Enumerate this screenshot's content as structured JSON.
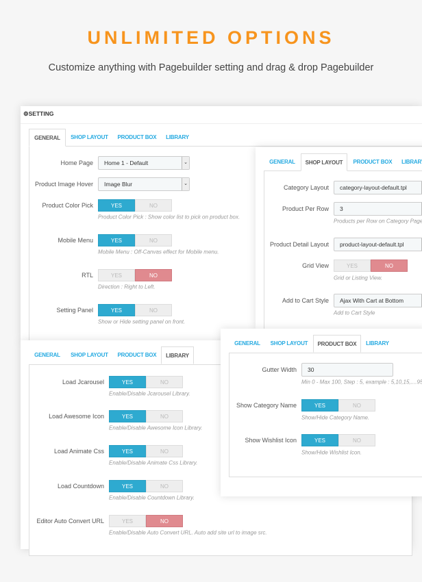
{
  "hero": {
    "title": "UNLIMITED OPTIONS",
    "subtitle": "Customize anything with Pagebuilder setting and drag & drop Pagebuilder"
  },
  "colors": {
    "accent": "#f7941d",
    "yes": "#2eaad0",
    "no": "#e08a8f",
    "tab_link": "#25aae1"
  },
  "setting_header": {
    "icon": "gears-icon",
    "label": "SETTING"
  },
  "tabs": [
    "GENERAL",
    "SHOP LAYOUT",
    "PRODUCT BOX",
    "LIBRARY"
  ],
  "toggle": {
    "yes": "YES",
    "no": "NO"
  },
  "panels": [
    {
      "id": "general",
      "active_tab": 0,
      "rows": [
        {
          "label": "Home Page",
          "type": "select",
          "value": "Home 1 - Default"
        },
        {
          "label": "Product Image Hover",
          "type": "select",
          "value": "Image Blur"
        },
        {
          "label": "Product Color Pick",
          "type": "toggle",
          "value": "YES",
          "help": "Product Color Pick : Show color list to pick on product box."
        },
        {
          "label": "Mobile Menu",
          "type": "toggle",
          "value": "YES",
          "help": "Mobile Menu : Off-Canvas effect for Mobile menu."
        },
        {
          "label": "RTL",
          "type": "toggle",
          "value": "NO",
          "help": "Direction : Right to Left."
        },
        {
          "label": "Setting Panel",
          "type": "toggle",
          "value": "YES",
          "help": "Show or Hide setting panel on front."
        }
      ]
    },
    {
      "id": "shop-layout",
      "active_tab": 1,
      "rows": [
        {
          "label": "Category Layout",
          "type": "select",
          "value": "category-layout-default.tpl"
        },
        {
          "label": "Product Per Row",
          "type": "select",
          "value": "3",
          "help": "Products per Row on Category Page"
        },
        {
          "label": "Product Detail Layout",
          "type": "select",
          "value": "product-layout-default.tpl"
        },
        {
          "label": "Grid View",
          "type": "toggle",
          "value": "NO",
          "help": "Grid or Listing View."
        },
        {
          "label": "Add to Cart Style",
          "type": "select",
          "value": "Ajax With Cart at Bottom",
          "help": "Add to Cart Style"
        }
      ]
    },
    {
      "id": "library",
      "active_tab": 3,
      "rows": [
        {
          "label": "Load Jcarousel",
          "type": "toggle",
          "value": "YES",
          "help": "Enable/Disable Jcarousel Library."
        },
        {
          "label": "Load Awesome Icon",
          "type": "toggle",
          "value": "YES",
          "help": "Enable/Disable Awesome Icon Library."
        },
        {
          "label": "Load Animate Css",
          "type": "toggle",
          "value": "YES",
          "help": "Enable/Disable Animate Css Library."
        },
        {
          "label": "Load Countdown",
          "type": "toggle",
          "value": "YES",
          "help": "Enable/Disable Countdown Library."
        },
        {
          "label": "Editor Auto Convert URL",
          "type": "toggle",
          "value": "NO",
          "help": "Enable/Disable Auto Convert URL. Auto add site url to image src."
        }
      ]
    },
    {
      "id": "product-box",
      "active_tab": 2,
      "rows": [
        {
          "label": "Gutter Width",
          "type": "input",
          "value": "30",
          "help": "Min 0 - Max 100, Step : 5, example : 5,10,15,....95"
        },
        {
          "label": "Show Category Name",
          "type": "toggle",
          "value": "YES",
          "help": "Show/Hide Category Name."
        },
        {
          "label": "Show Wishlist Icon",
          "type": "toggle",
          "value": "YES",
          "help": "Show/Hide Wishlist Icon."
        }
      ]
    }
  ]
}
